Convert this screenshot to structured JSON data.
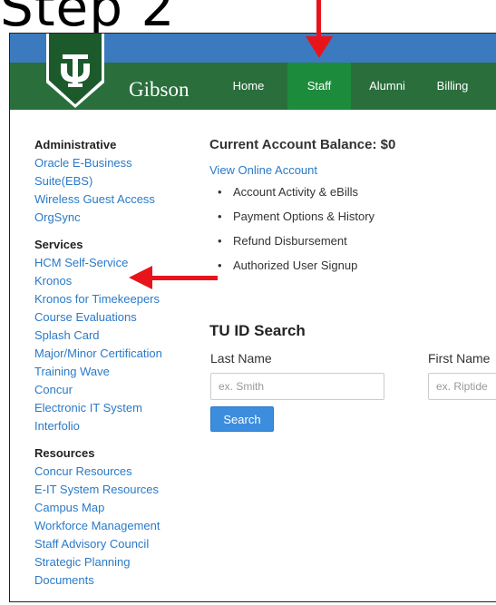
{
  "step_title": "Step 2",
  "header": {
    "brand": "Gibson",
    "nav": [
      "Home",
      "Staff",
      "Alumni",
      "Billing"
    ],
    "active_nav": "Staff"
  },
  "sidebar": {
    "groups": [
      {
        "heading": "Administrative",
        "links": [
          "Oracle E-Business Suite(EBS)",
          "Wireless Guest Access",
          "OrgSync"
        ]
      },
      {
        "heading": "Services",
        "links": [
          "HCM Self-Service",
          "Kronos",
          "Kronos for Timekeepers",
          "Course Evaluations",
          "Splash Card",
          "Major/Minor Certification",
          "Training Wave",
          "Concur",
          "Electronic IT System",
          "Interfolio"
        ]
      },
      {
        "heading": "Resources",
        "links": [
          "Concur Resources",
          "E-IT System Resources",
          "Campus Map",
          "Workforce Management",
          "Staff Advisory Council",
          "Strategic Planning",
          "Documents"
        ]
      }
    ]
  },
  "account": {
    "balance_heading": "Current Account Balance: $0",
    "view_link": "View Online Account",
    "items": [
      "Account Activity & eBills",
      "Payment Options & History",
      "Refund Disbursement",
      "Authorized User Signup"
    ]
  },
  "id_search": {
    "title": "TU ID Search",
    "last_name_label": "Last Name",
    "last_name_placeholder": "ex. Smith",
    "first_name_label": "First Name",
    "first_name_placeholder": "ex. Riptide",
    "button": "Search"
  },
  "colors": {
    "nav_green": "#2a6e3c",
    "active_green": "#1d8b3c",
    "top_blue": "#3c7ac0",
    "link_blue": "#2a7ac7",
    "annotation_red": "#e8141b"
  }
}
